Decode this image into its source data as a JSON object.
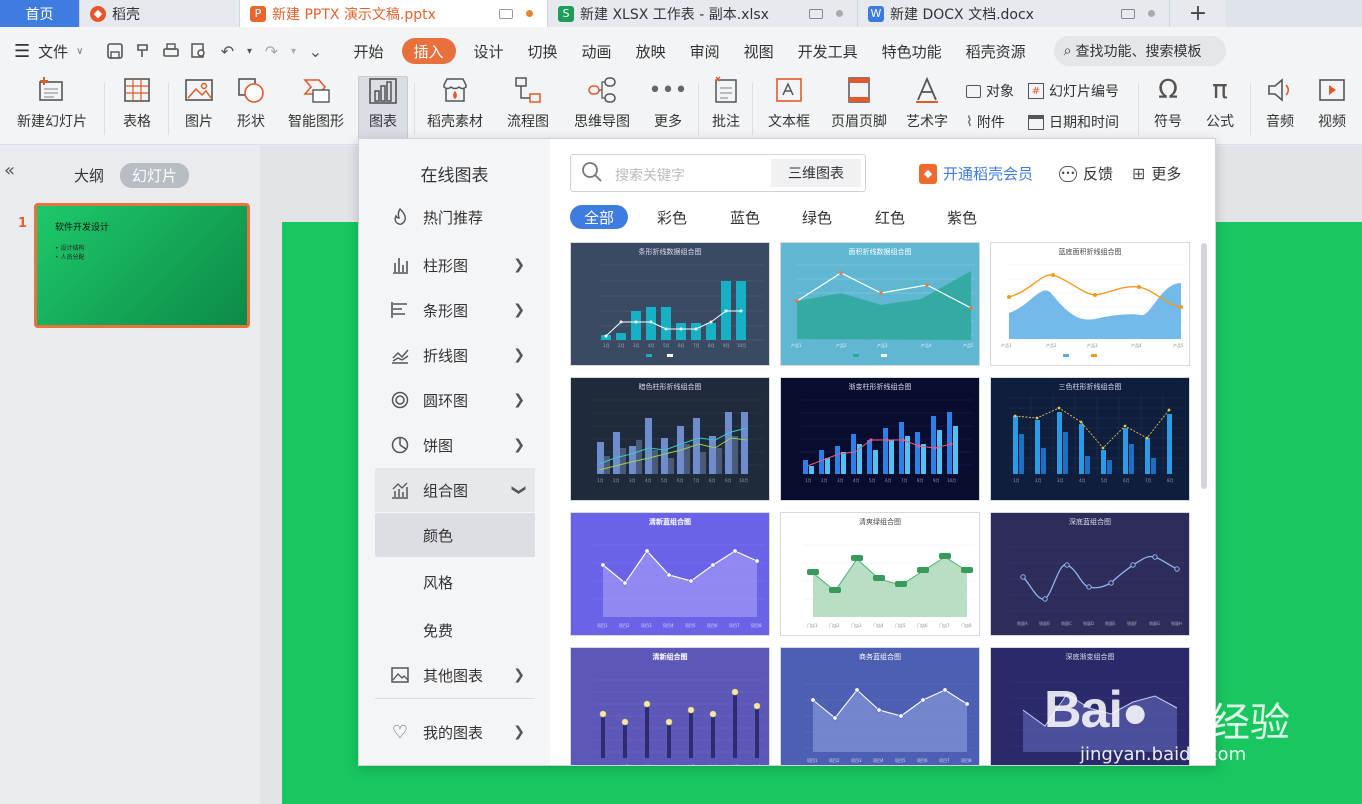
{
  "tabs": {
    "home": "首页",
    "daoke": "稻壳",
    "pptx": "新建 PPTX 演示文稿.pptx",
    "xlsx": "新建 XLSX 工作表 - 副本.xlsx",
    "docx": "新建 DOCX 文档.docx",
    "add": "+"
  },
  "menubar": {
    "file": "文件",
    "items": [
      "开始",
      "插入",
      "设计",
      "切换",
      "动画",
      "放映",
      "审阅",
      "视图",
      "开发工具",
      "特色功能",
      "稻壳资源"
    ],
    "search": "查找功能、搜索模板"
  },
  "ribbon": {
    "new_slide": "新建幻灯片",
    "table": "表格",
    "picture": "图片",
    "shape": "形状",
    "smart_art": "智能图形",
    "chart": "图表",
    "daoke_assets": "稻壳素材",
    "flowchart": "流程图",
    "mindmap": "思维导图",
    "more": "更多",
    "comment": "批注",
    "textbox": "文本框",
    "header_footer": "页眉页脚",
    "wordart": "艺术字",
    "object": "对象",
    "attachment": "附件",
    "slide_number": "幻灯片编号",
    "datetime": "日期和时间",
    "symbol": "符号",
    "formula": "公式",
    "audio": "音频",
    "video": "视频"
  },
  "leftpane": {
    "collapse": "«",
    "outline_tab": "大纲",
    "slides_tab": "幻灯片",
    "slide_number": "1",
    "slide_title": "软件开发设计",
    "slide_bullets": [
      "• 设计结构",
      "• 人员分配"
    ]
  },
  "dropdown": {
    "heading": "在线图表",
    "categories": [
      {
        "label": "热门推荐"
      },
      {
        "label": "柱形图"
      },
      {
        "label": "条形图"
      },
      {
        "label": "折线图"
      },
      {
        "label": "圆环图"
      },
      {
        "label": "饼图"
      },
      {
        "label": "组合图"
      }
    ],
    "subitems": [
      "颜色",
      "风格",
      "免费"
    ],
    "other_charts": "其他图表",
    "my_charts": "我的图表",
    "search_placeholder": "搜索关键字",
    "search_tag": "三维图表",
    "vip": "开通稻壳会员",
    "feedback": "反馈",
    "more": "更多",
    "filters": [
      "全部",
      "彩色",
      "蓝色",
      "绿色",
      "红色",
      "紫色"
    ],
    "thumb_titles": [
      "条形折线数据组合图",
      "面积折线数据组合图",
      "蓝底面积折线组合图",
      "暗色柱形折线组合图",
      "渐变柱形折线组合图",
      "三色柱形折线组合图",
      "清新蓝组合图",
      "清爽绿组合图",
      "深底蓝组合图",
      "清新组合图",
      "商务蓝组合图",
      "深底渐变组合图"
    ]
  },
  "watermark": {
    "brand": "Bai",
    "brand_cn": "经验",
    "url": "jingyan.baidu.com"
  }
}
